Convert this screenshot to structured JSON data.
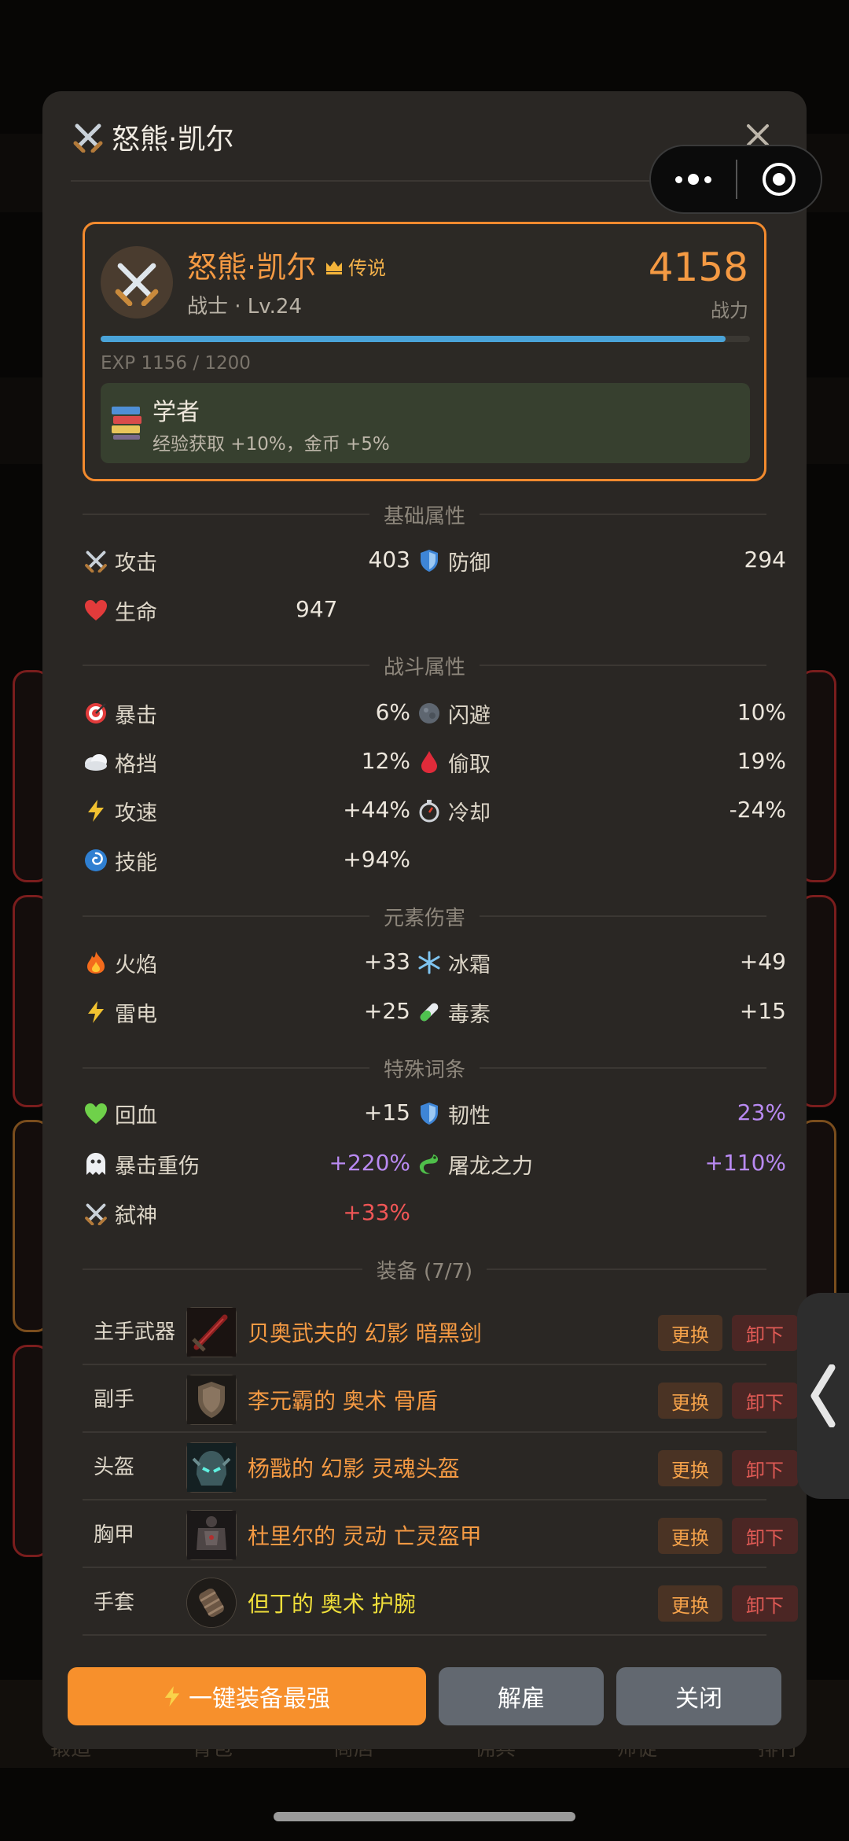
{
  "modal": {
    "title": "怒熊·凯尔",
    "close_icon": "close-icon"
  },
  "hero": {
    "name": "怒熊·凯尔",
    "rarity": "传说",
    "class_level": "战士 · Lv.24",
    "power": "4158",
    "power_label": "战力",
    "exp_text": "EXP 1156 / 1200",
    "exp_fraction": 0.963,
    "trait_name": "学者",
    "trait_desc": "经验获取 +10%，金币 +5%"
  },
  "sections": {
    "basic": "基础属性",
    "combat": "战斗属性",
    "element": "元素伤害",
    "special": "特殊词条",
    "equipment": "装备 (7/7)"
  },
  "stats": {
    "attack": {
      "label": "攻击",
      "value": "403",
      "icon": "swords-icon"
    },
    "defense": {
      "label": "防御",
      "value": "294",
      "icon": "shield-icon"
    },
    "hp": {
      "label": "生命",
      "value": "947",
      "icon": "heart-icon"
    },
    "crit": {
      "label": "暴击",
      "value": "6%",
      "icon": "target-icon"
    },
    "dodge": {
      "label": "闪避",
      "value": "10%",
      "icon": "dodge-icon"
    },
    "block": {
      "label": "格挡",
      "value": "12%",
      "icon": "cloud-icon"
    },
    "steal": {
      "label": "偷取",
      "value": "19%",
      "icon": "blood-drop-icon"
    },
    "speed": {
      "label": "攻速",
      "value": "+44%",
      "icon": "lightning-icon"
    },
    "cooldown": {
      "label": "冷却",
      "value": "-24%",
      "icon": "stopwatch-icon"
    },
    "skill": {
      "label": "技能",
      "value": "+94%",
      "icon": "swirl-icon"
    },
    "fire": {
      "label": "火焰",
      "value": "+33",
      "icon": "fire-icon"
    },
    "frost": {
      "label": "冰霜",
      "value": "+49",
      "icon": "snowflake-icon"
    },
    "thunder": {
      "label": "雷电",
      "value": "+25",
      "icon": "lightning-icon"
    },
    "poison": {
      "label": "毒素",
      "value": "+15",
      "icon": "test-tube-icon"
    },
    "regen": {
      "label": "回血",
      "value": "+15",
      "icon": "green-heart-icon"
    },
    "tough": {
      "label": "韧性",
      "value": "23%",
      "icon": "shield-icon"
    },
    "critdmg": {
      "label": "暴击重伤",
      "value": "+220%",
      "icon": "ghost-icon"
    },
    "dragon": {
      "label": "屠龙之力",
      "value": "+110%",
      "icon": "dragon-icon"
    },
    "godslayer": {
      "label": "弑神",
      "value": "+33%",
      "icon": "swords-icon"
    }
  },
  "equipment": [
    {
      "slot": "主手武器",
      "name": "贝奥武夫的 幻影 暗黑剑",
      "color": "#f59a43"
    },
    {
      "slot": "副手",
      "name": "李元霸的 奥术 骨盾",
      "color": "#f59a43"
    },
    {
      "slot": "头盔",
      "name": "杨戬的 幻影 灵魂头盔",
      "color": "#f59a43"
    },
    {
      "slot": "胸甲",
      "name": "杜里尔的 灵动 亡灵盔甲",
      "color": "#f59a43"
    },
    {
      "slot": "手套",
      "name": "但丁的 奥术 护腕",
      "color": "#f0df3a"
    }
  ],
  "equip_actions": {
    "swap": "更换",
    "unequip": "卸下"
  },
  "footer": {
    "auto_equip": "一键装备最强",
    "dismiss": "解雇",
    "close": "关闭"
  },
  "background_tabs": [
    "锻造",
    "背包",
    "商店",
    "佣兵",
    "师徒",
    "排行"
  ],
  "colors": {
    "accent": "#f28a2e",
    "legendary": "#f59a43",
    "purple": "#b98af2",
    "red": "#f05656",
    "panel": "#2a2724"
  }
}
